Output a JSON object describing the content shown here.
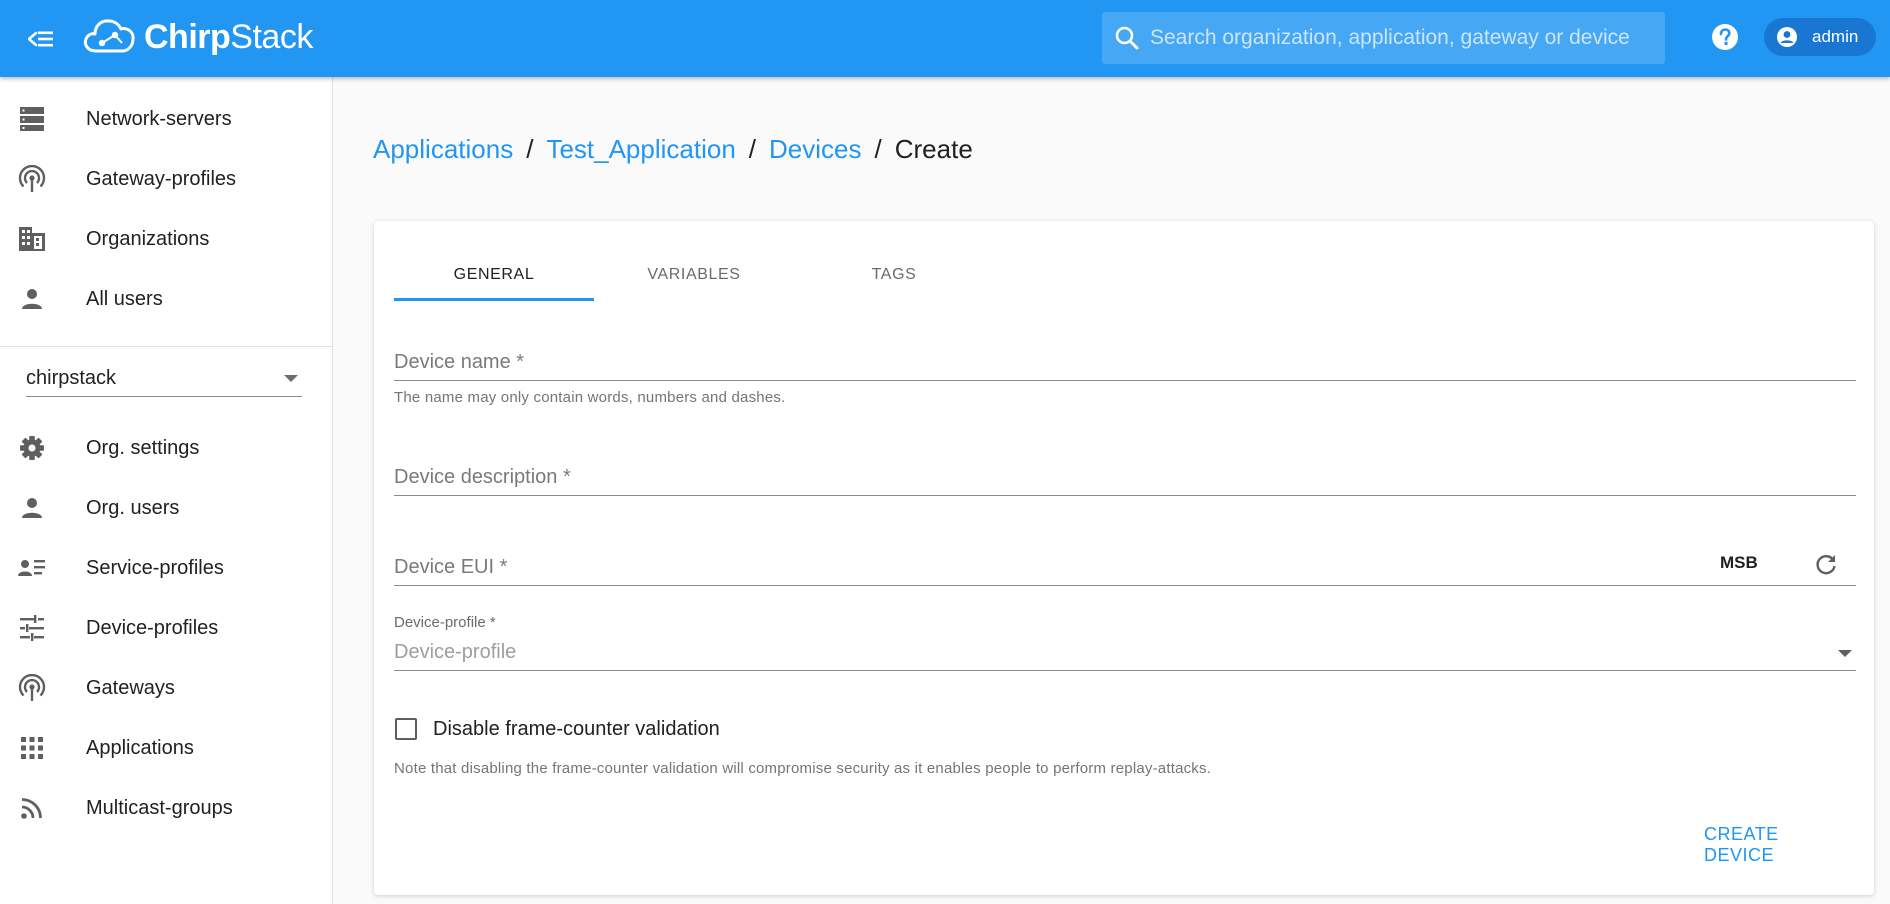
{
  "header": {
    "logo_text_bold": "Chirp",
    "logo_text": "Stack",
    "search_placeholder": "Search organization, application, gateway or device",
    "user_name": "admin"
  },
  "sidebar": {
    "admin_items": [
      {
        "label": "Network-servers",
        "icon": "server-icon"
      },
      {
        "label": "Gateway-profiles",
        "icon": "antenna-icon"
      },
      {
        "label": "Organizations",
        "icon": "building-icon"
      },
      {
        "label": "All users",
        "icon": "person-icon"
      }
    ],
    "org_selector_value": "chirpstack",
    "org_items": [
      {
        "label": "Org. settings",
        "icon": "gear-icon"
      },
      {
        "label": "Org. users",
        "icon": "person-icon"
      },
      {
        "label": "Service-profiles",
        "icon": "person-list-icon"
      },
      {
        "label": "Device-profiles",
        "icon": "sliders-icon"
      },
      {
        "label": "Gateways",
        "icon": "antenna-icon"
      },
      {
        "label": "Applications",
        "icon": "grid-icon"
      },
      {
        "label": "Multicast-groups",
        "icon": "rss-icon"
      }
    ]
  },
  "breadcrumb": {
    "items": [
      "Applications",
      "Test_Application",
      "Devices"
    ],
    "separator": "/",
    "current": "Create"
  },
  "tabs": [
    {
      "label": "GENERAL",
      "active": true
    },
    {
      "label": "VARIABLES",
      "active": false
    },
    {
      "label": "TAGS",
      "active": false
    }
  ],
  "form": {
    "device_name": {
      "label": "Device name *",
      "value": "",
      "helper": "The name may only contain words, numbers and dashes."
    },
    "device_description": {
      "label": "Device description *",
      "value": ""
    },
    "device_eui": {
      "label": "Device EUI *",
      "value": "",
      "byte_order_label": "MSB"
    },
    "device_profile": {
      "label": "Device-profile *",
      "placeholder": "Device-profile"
    },
    "disable_fcnt": {
      "label": "Disable frame-counter validation",
      "checked": false,
      "helper": "Note that disabling the frame-counter validation will compromise security as it enables people to perform replay-attacks."
    },
    "submit_label": "CREATE DEVICE"
  },
  "colors": {
    "primary": "#2196f3",
    "primary_dark": "#1976d2",
    "background": "#fafafa"
  }
}
